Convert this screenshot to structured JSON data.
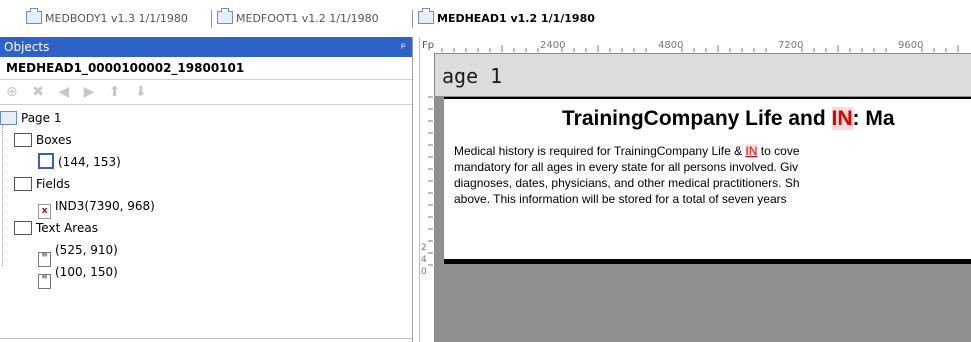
{
  "tabs": [
    {
      "label": "MEDBODY1 v1.3 1/1/1980"
    },
    {
      "label": "MEDFOOT1 v1.2 1/1/1980"
    },
    {
      "label": "MEDHEAD1 v1.2 1/1/1980"
    }
  ],
  "objects_panel": {
    "title": "Objects",
    "pin": "ᵖ",
    "object_name": "MEDHEAD1_0000100002_19800101",
    "toolbar_glyphs": "⊕ ✖ ◀ ▶ ⬆ ⬇",
    "tree": {
      "page": "Page 1",
      "boxes_label": "Boxes",
      "box_items": [
        "(144, 153)"
      ],
      "fields_label": "Fields",
      "field_items": [
        "IND3(7390, 968)"
      ],
      "textareas_label": "Text Areas",
      "textarea_items": [
        "(525, 910)",
        "(100, 150)"
      ]
    }
  },
  "designer": {
    "ruler_labels": [
      "Fp",
      "2400",
      "4800",
      "7200",
      "9600"
    ],
    "page_label": "age 1",
    "doc_title_prefix": "TrainingCompany Life and ",
    "doc_title_field": "IN",
    "doc_title_suffix": ": Ma",
    "body_line1_prefix": "Medical history is required for TrainingCompany Life & ",
    "body_line1_field": "IN",
    "body_line1_suffix": " to cove",
    "body_line2": "mandatory for all ages in every state for all persons involved. Giv",
    "body_line3": "diagnoses, dates, physicians, and other medical practitioners. Sh",
    "body_line4": "above. This information will be stored for a total of seven years",
    "vruler_marks": [
      "2",
      "4",
      "0"
    ]
  }
}
